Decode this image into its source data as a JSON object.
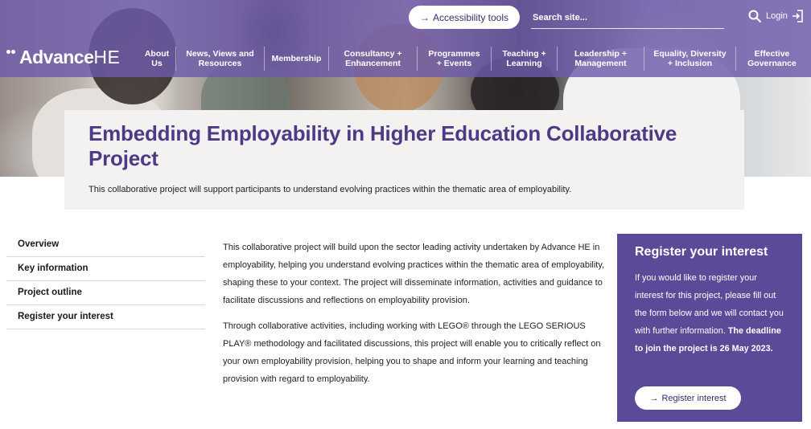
{
  "header": {
    "accessibility_label": "Accessibility tools",
    "search_placeholder": "Search site...",
    "login_label": "Login",
    "logo_bold": "Advance",
    "logo_light": "HE"
  },
  "nav": {
    "items": [
      {
        "label": "About Us"
      },
      {
        "label": "News, Views and Resources"
      },
      {
        "label": "Membership"
      },
      {
        "label": "Consultancy + Enhancement"
      },
      {
        "label": "Programmes + Events"
      },
      {
        "label": "Teaching + Learning"
      },
      {
        "label": "Leadership + Management"
      },
      {
        "label": "Equality, Diversity + Inclusion"
      },
      {
        "label": "Effective Governance"
      }
    ]
  },
  "page": {
    "title": "Embedding Employability in Higher Education Collaborative Project",
    "intro": "This collaborative project will support participants to understand evolving practices within the thematic area of employability."
  },
  "sidebar": {
    "items": [
      {
        "label": "Overview"
      },
      {
        "label": "Key information"
      },
      {
        "label": "Project outline"
      },
      {
        "label": "Register your interest"
      }
    ]
  },
  "main": {
    "paragraphs": [
      "This collaborative project will build upon the sector leading activity undertaken by Advance HE in employability, helping you understand evolving practices within the thematic area of employability, shaping these to your context. The project will disseminate information, activities and guidance to facilitate discussions and reflections on employability provision.",
      "Through collaborative activities, including working with LEGO® through the LEGO SERIOUS PLAY® methodology and facilitated discussions, this project will enable you to critically reflect on your own employability provision, helping you to shape and inform your learning and teaching provision with regard to employability."
    ]
  },
  "register": {
    "title": "Register your interest",
    "text": "If you would like to register your interest for this project, please fill out the form below and we will contact you with further information.",
    "deadline": "The deadline to join the project is 26 May 2023.",
    "button_label": "Register interest"
  },
  "colors": {
    "brand_purple": "#5b4a97",
    "title_purple": "#4d3a87"
  }
}
